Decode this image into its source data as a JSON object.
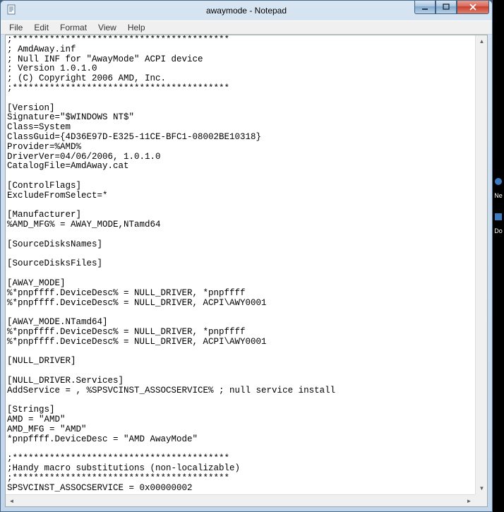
{
  "window": {
    "title": "awaymode - Notepad"
  },
  "menu": {
    "file": "File",
    "edit": "Edit",
    "format": "Format",
    "view": "View",
    "help": "Help"
  },
  "editor": {
    "content": ";*****************************************\n; AmdAway.inf\n; Null INF for \"AwayMode\" ACPI device\n; Version 1.0.1.0\n; (C) Copyright 2006 AMD, Inc.\n;*****************************************\n\n[Version]\nSignature=\"$WINDOWS NT$\"\nClass=System\nClassGuid={4D36E97D-E325-11CE-BFC1-08002BE10318}\nProvider=%AMD%\nDriverVer=04/06/2006, 1.0.1.0\nCatalogFile=AmdAway.cat\n\n[ControlFlags]\nExcludeFromSelect=*\n\n[Manufacturer]\n%AMD_MFG% = AWAY_MODE,NTamd64\n\n[SourceDisksNames]\n\n[SourceDisksFiles]\n\n[AWAY_MODE]\n%*pnpffff.DeviceDesc% = NULL_DRIVER, *pnpffff\n%*pnpffff.DeviceDesc% = NULL_DRIVER, ACPI\\AWY0001\n\n[AWAY_MODE.NTamd64]\n%*pnpffff.DeviceDesc% = NULL_DRIVER, *pnpffff\n%*pnpffff.DeviceDesc% = NULL_DRIVER, ACPI\\AWY0001\n\n[NULL_DRIVER]\n\n[NULL_DRIVER.Services]\nAddService = , %SPSVCINST_ASSOCSERVICE% ; null service install\n\n[Strings]\nAMD = \"AMD\"\nAMD_MFG = \"AMD\"\n*pnpffff.DeviceDesc = \"AMD AwayMode\"\n\n;*****************************************\n;Handy macro substitutions (non-localizable)\n;*****************************************\nSPSVCINST_ASSOCSERVICE = 0x00000002"
  },
  "right_strip": {
    "item1": "Ne",
    "item2": "Do"
  }
}
